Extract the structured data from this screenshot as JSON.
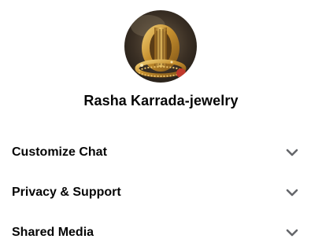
{
  "profile": {
    "name": "Rasha Karrada-jewelry",
    "avatar_icon": "profile-photo-gold-rings"
  },
  "menu": {
    "items": [
      {
        "label": "Customize Chat",
        "icon": "chevron-down-icon"
      },
      {
        "label": "Privacy & Support",
        "icon": "chevron-down-icon"
      },
      {
        "label": "Shared Media",
        "icon": "chevron-down-icon"
      }
    ]
  },
  "colors": {
    "text": "#050505",
    "chevron": "#65676b",
    "background": "#ffffff"
  }
}
